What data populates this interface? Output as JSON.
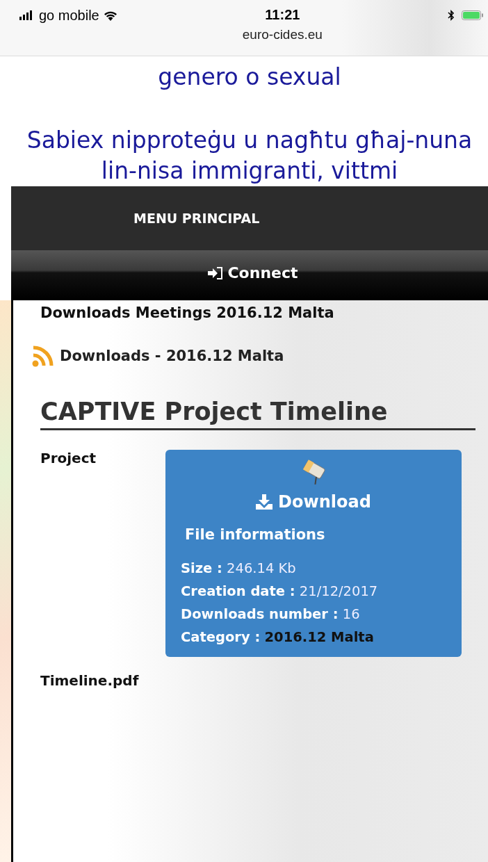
{
  "status_bar": {
    "carrier": "go mobile",
    "time": "11:21",
    "url": "euro-cides.eu"
  },
  "page_text": {
    "top_line": "genero o sexual",
    "paragraph": "Sabiex nipproteġu u nagħtu għaj-nuna lin-nisa immigranti, vittmi"
  },
  "menu": {
    "title": "MENU PRINCIPAL",
    "connect": "Connect"
  },
  "breadcrumb": "Downloads Meetings 2016.12 Malta",
  "feed_link": "Downloads - 2016.12 Malta",
  "heading": "CAPTIVE Project Timeline",
  "file": {
    "name_top": "Project",
    "name_bottom": "Timeline.pdf",
    "download": "Download",
    "info_title": "File informations",
    "info": [
      {
        "label": "Size :",
        "value": "246.14 Kb",
        "kind": "plain"
      },
      {
        "label": "Creation date :",
        "value": "21/12/2017",
        "kind": "plain"
      },
      {
        "label": "Downloads number :",
        "value": "16",
        "kind": "plain"
      },
      {
        "label": "Category :",
        "value": "2016.12 Malta",
        "kind": "strong"
      }
    ]
  }
}
